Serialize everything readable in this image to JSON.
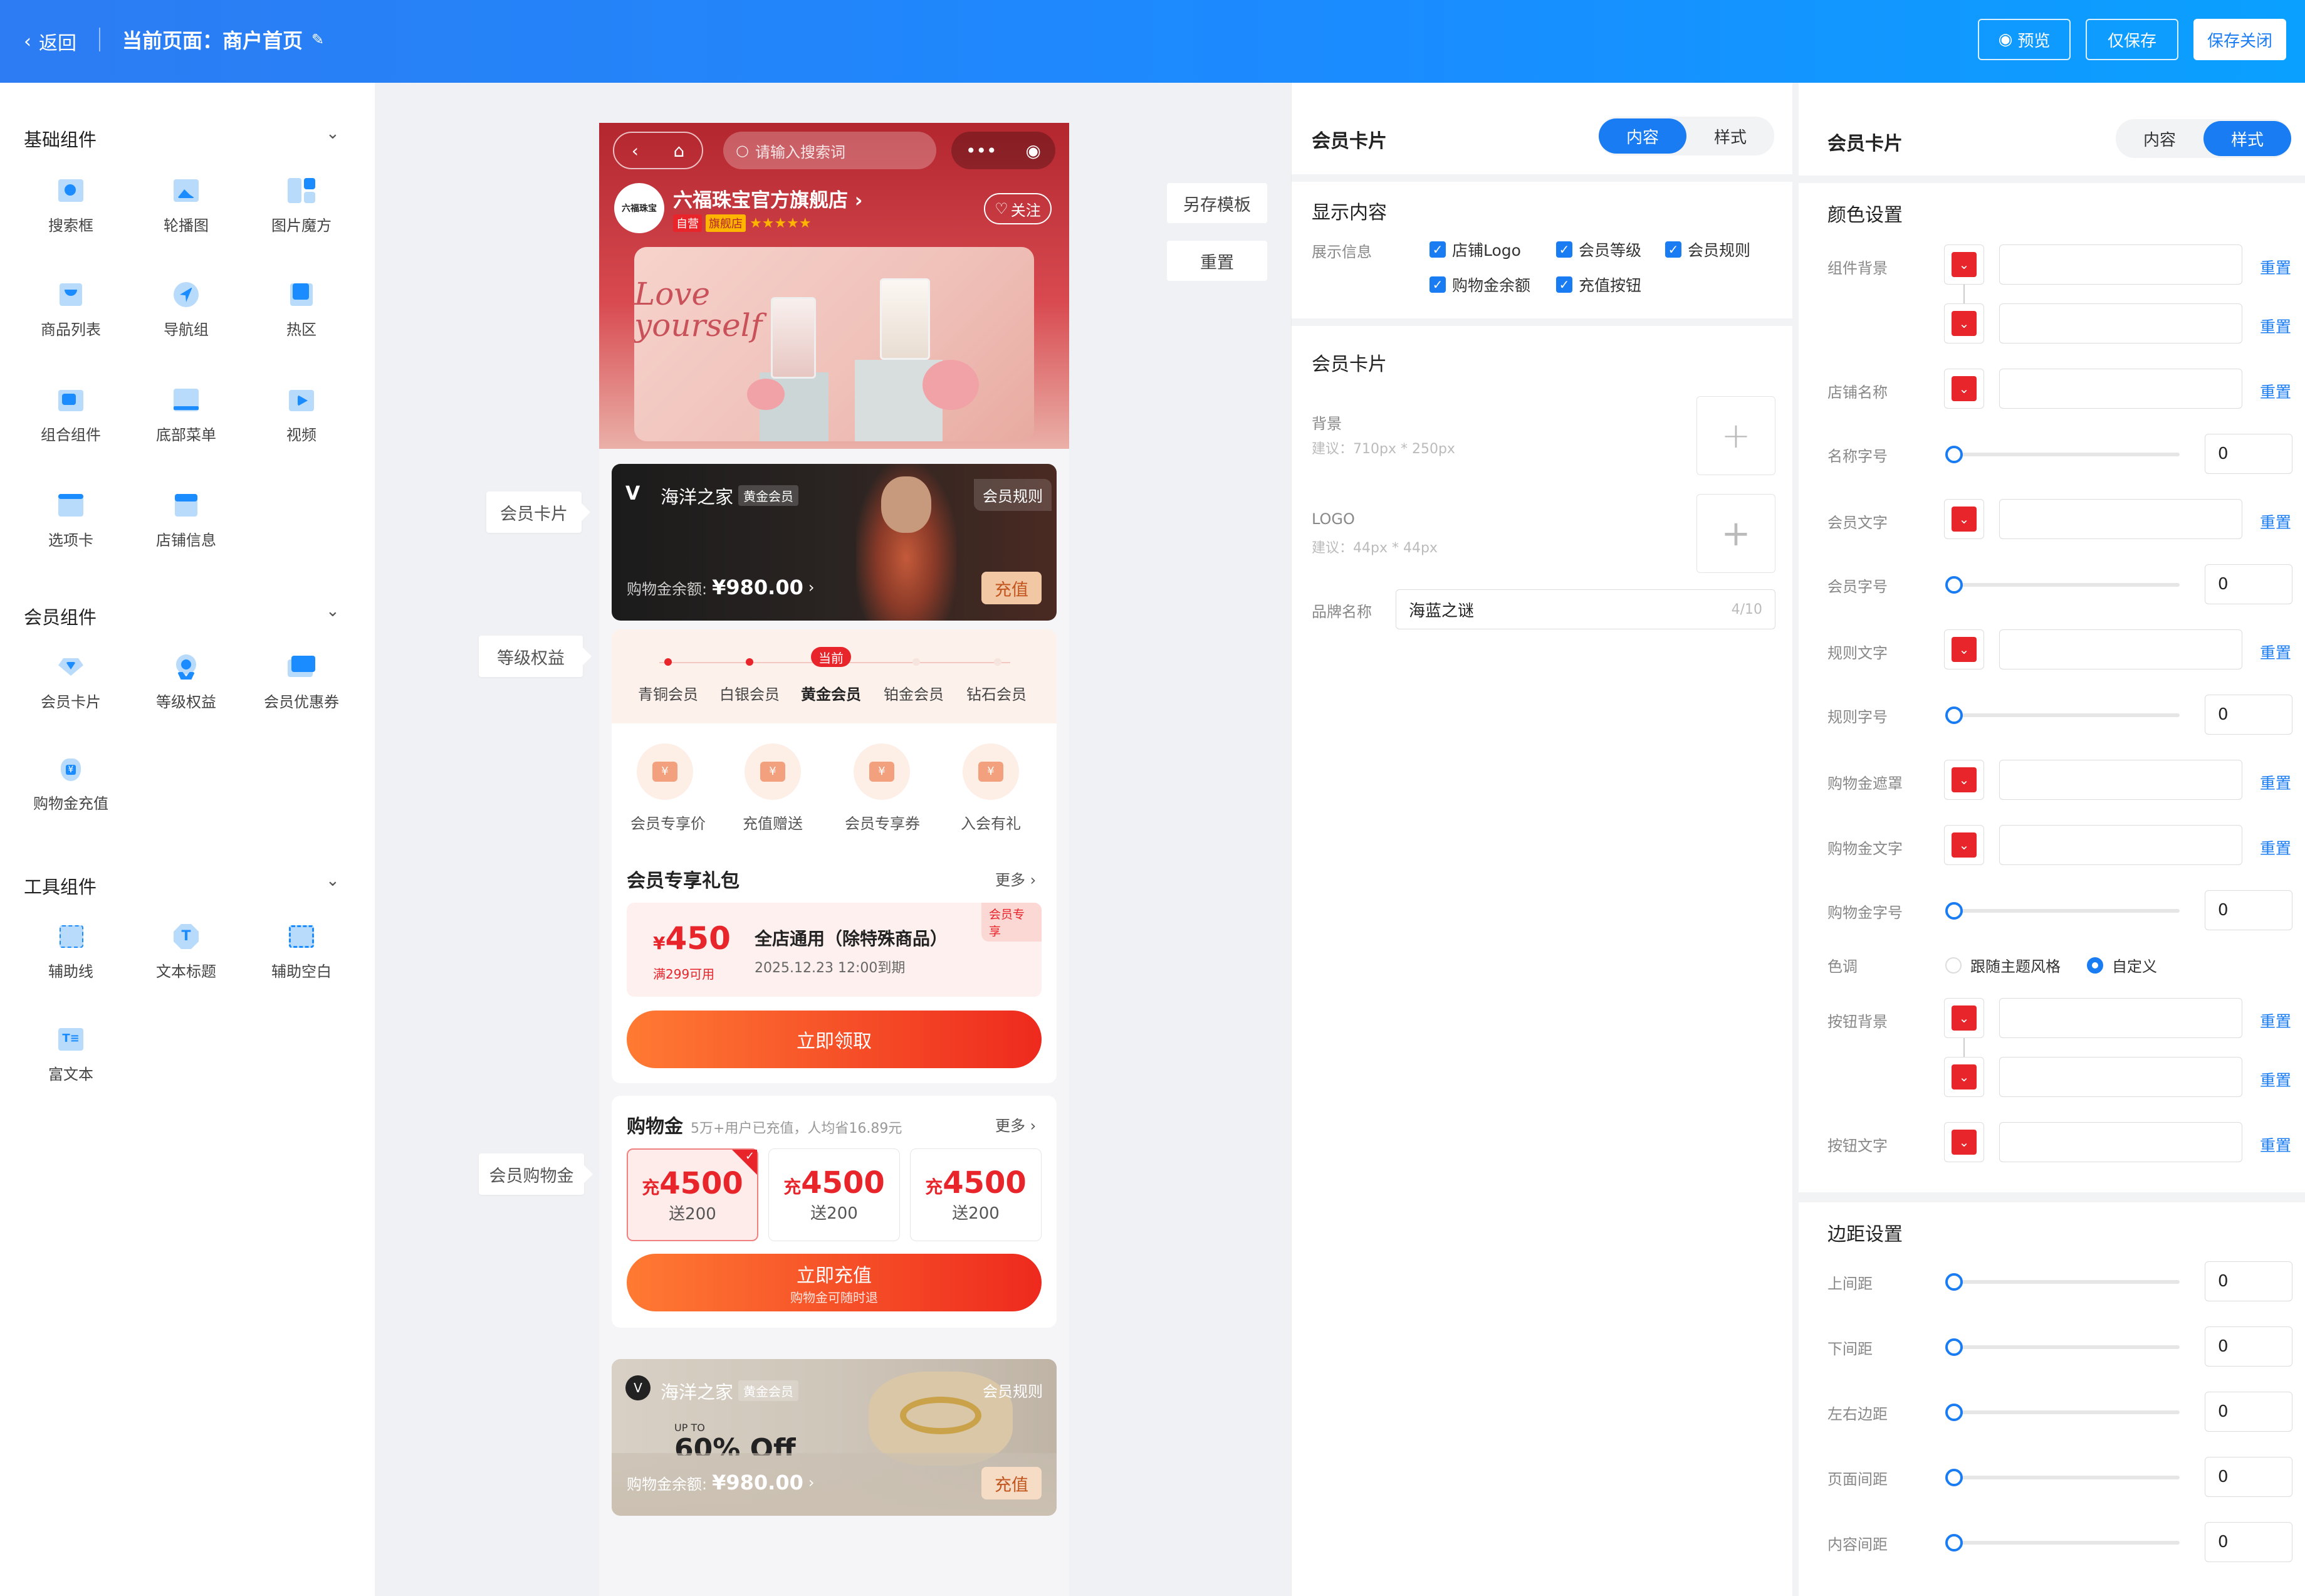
{
  "topbar": {
    "back": "返回",
    "title": "当前页面：商户首页",
    "preview": "预览",
    "save_only": "仅保存",
    "save_close": "保存关闭"
  },
  "left": {
    "groups": [
      {
        "title": "基础组件",
        "items": [
          "搜索框",
          "轮播图",
          "图片魔方",
          "商品列表",
          "导航组",
          "热区",
          "组合组件",
          "底部菜单",
          "视频",
          "选项卡",
          "店铺信息"
        ]
      },
      {
        "title": "会员组件",
        "items": [
          "会员卡片",
          "等级权益",
          "会员优惠券",
          "购物金充值"
        ]
      },
      {
        "title": "工具组件",
        "items": [
          "辅助线",
          "文本标题",
          "辅助空白",
          "富文本"
        ]
      }
    ]
  },
  "canvas": {
    "tags": {
      "card": "会员卡片",
      "benefit": "等级权益",
      "gold": "会员购物金"
    },
    "buttons": {
      "save_template": "另存模板",
      "reset": "重置"
    }
  },
  "phone": {
    "search_placeholder": "请输入搜索词",
    "store_name": "六福珠宝官方旗舰店",
    "store_logo": "六福珠宝",
    "badge_self": "自营",
    "badge_flag": "旗舰店",
    "follow": "关注",
    "banner_text": "Love yourself",
    "member_card": {
      "brand": "海洋之家",
      "level": "黄金会员",
      "rules": "会员规则",
      "balance_label": "购物金余额:",
      "balance": "¥980.00",
      "recharge": "充值"
    },
    "levels": {
      "current_tag": "当前",
      "items": [
        "青铜会员",
        "白银会员",
        "黄金会员",
        "铂金会员",
        "钻石会员"
      ]
    },
    "perks": [
      "会员专享价",
      "充值赠送",
      "会员专享券",
      "入会有礼"
    ],
    "gift": {
      "title": "会员专享礼包",
      "more": "更多",
      "tag": "会员专享",
      "price_sym": "¥",
      "price": "450",
      "cond": "满299可用",
      "name": "全店通用（除特殊商品）",
      "expire": "2025.12.23 12:00到期",
      "btn": "立即领取"
    },
    "gold": {
      "title": "购物金",
      "sub": "5万+用户已充值，人均省16.89元",
      "more": "更多",
      "options": [
        {
          "pre": "充",
          "amt": "4500",
          "gift": "送200"
        },
        {
          "pre": "充",
          "amt": "4500",
          "gift": "送200"
        },
        {
          "pre": "充",
          "amt": "4500",
          "gift": "送200"
        }
      ],
      "btn": "立即充值",
      "btn_sub": "购物金可随时退"
    },
    "card2": {
      "brand": "海洋之家",
      "level": "黄金会员",
      "rules": "会员规则",
      "promo_small": "UP TO",
      "promo": "60% Off",
      "balance_label": "购物金余额:",
      "balance": "¥980.00",
      "recharge": "充值"
    }
  },
  "mid": {
    "title": "会员卡片",
    "tab_content": "内容",
    "tab_style": "样式",
    "display_title": "显示内容",
    "display_label": "展示信息",
    "checks": [
      "店铺Logo",
      "会员等级",
      "会员规则",
      "购物金余额",
      "充值按钮"
    ],
    "card_title": "会员卡片",
    "bg_label": "背景",
    "bg_hint": "建议：710px * 250px",
    "logo_label": "LOGO",
    "logo_hint": "建议：44px * 44px",
    "brand_label": "品牌名称",
    "brand_value": "海蓝之谜",
    "brand_count": "4/10"
  },
  "right": {
    "title": "会员卡片",
    "tab_content": "内容",
    "tab_style": "样式",
    "color_title": "颜色设置",
    "reset": "重置",
    "rows": [
      "组件背景",
      "店铺名称",
      "名称字号",
      "会员文字",
      "会员字号",
      "规则文字",
      "规则字号",
      "购物金遮罩",
      "购物金文字",
      "购物金字号",
      "色调",
      "按钮背景",
      "按钮文字"
    ],
    "slider_value": "0",
    "tone_opt1": "跟随主题风格",
    "tone_opt2": "自定义",
    "margin_title": "边距设置",
    "margins": [
      "上间距",
      "下间距",
      "左右边距",
      "页面间距",
      "内容间距"
    ],
    "accent": "#1a7cf3",
    "brand_red": "#e8252b"
  }
}
